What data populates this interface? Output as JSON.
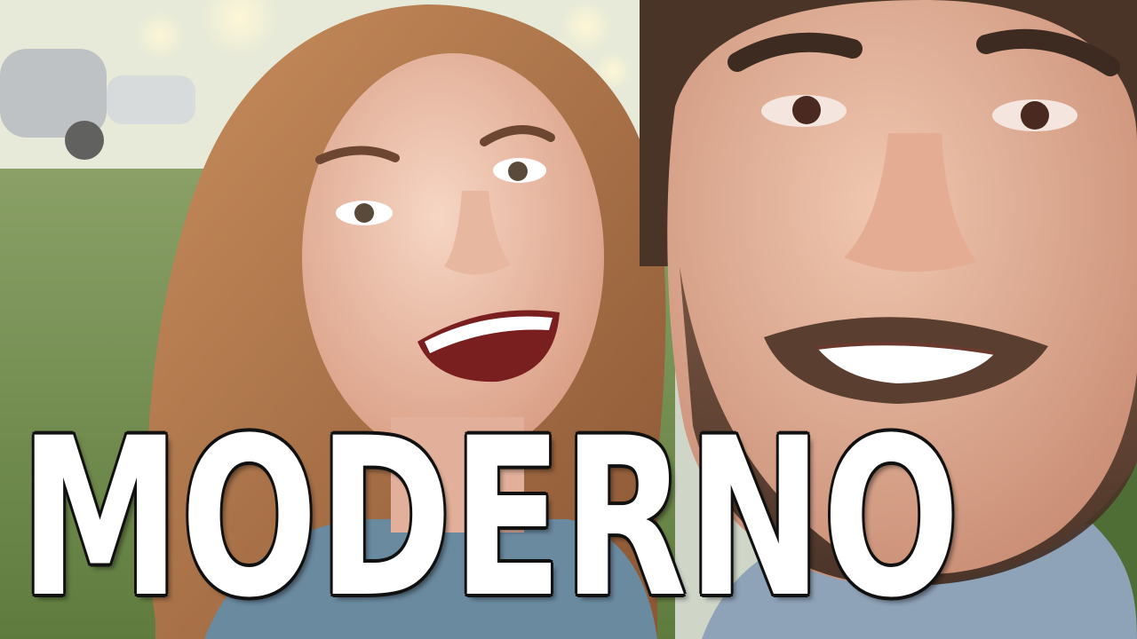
{
  "title": "MODERNO",
  "colors": {
    "title_fill": "#ffffff",
    "title_outline": "#111111",
    "foliage": "#6f8a52"
  }
}
